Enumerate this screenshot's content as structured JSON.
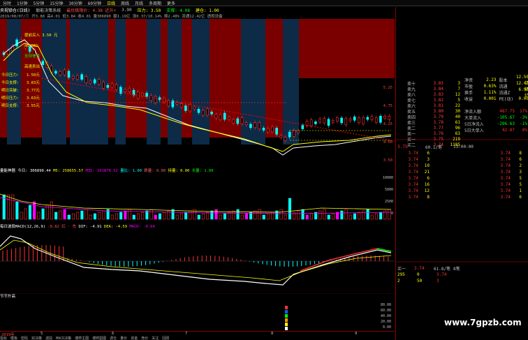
{
  "period_tabs": [
    "分时",
    "1分钟",
    "5分钟",
    "15分钟",
    "30分钟",
    "60分钟",
    "日线",
    "周线",
    "月线",
    "多周期",
    "更多"
  ],
  "active_period": "日线",
  "title": {
    "stock": "央视锁仓(日线)",
    "indicator": "聪能决策系统",
    "signal": "最优极限价: 4.38 近升+",
    "high": "3.90",
    "pressure": "压力: 3.50",
    "support": "支撑: 4.08",
    "position": "建仓: 1.00"
  },
  "info_line": "2019/08/07/三 开3.88 高4.01 低3.84 收4.01 量306890 额1.19亿 涨0.37/10.14% 换2.48% 流通12.42亿 透视设备",
  "main_annotations": {
    "buy_label": "提前买入 3.50 元",
    "a_label": "a0.86%",
    "support_label": "支持信号",
    "sell_label": "高速卖出",
    "today_pressure": "今日压力:",
    "today_support": "今日支撑:",
    "tomorrow_break": "明日突破:",
    "tomorrow_pressure": "明日压力:",
    "tomorrow_support": "明日支撑:",
    "tomorrow_low": "明日强势:"
  },
  "main_values": [
    "1.50元",
    "3.83元",
    "3.77元",
    "3.63元",
    "3.55元"
  ],
  "main_price_axis": [
    "5.25",
    "4.75",
    "4.25",
    "4.00",
    "3.50"
  ],
  "vol_header": {
    "name": "量能神器",
    "today": "今日: 306890.44",
    "m5": "M5: 258655.57",
    "m35": "M35: 101879.52",
    "vol_ratio": "量比: 1.00",
    "drop": "跌量: 0.00",
    "hold": "持量: 0.00",
    "long": "长量: 1.00"
  },
  "vol_axis": [
    "10000",
    "5000",
    "2500",
    "0"
  ],
  "macd_header": {
    "name": "每日波段MACD(12,26,9)",
    "dif_label": "DIF: -4.91",
    "dea_label": "DEA: -4.59",
    "macd_label": "MACD: -0.64",
    "extra": "-8.82 红 · 先"
  },
  "sig_header": {
    "name": "节节升高"
  },
  "sig_axis": [
    "80.00",
    "60.00",
    "40.00",
    "20.00",
    "0.00"
  ],
  "x_labels": [
    "2019年",
    "5",
    "6",
    "7",
    "8",
    "9"
  ],
  "bottom_tabs": [
    "指标",
    "模板",
    "密码",
    "双决策",
    "波段",
    "MACD决策",
    "博弈主图",
    "博弈副图",
    "调仓",
    "量价",
    "资金",
    "竞价",
    "关注",
    "回顾"
  ],
  "right_quotes": [
    {
      "label": "卖十",
      "price": "3.85",
      "vol": "3"
    },
    {
      "label": "卖九",
      "price": "3.84",
      "vol": "7"
    },
    {
      "label": "卖八",
      "price": "3.83",
      "vol": "12"
    },
    {
      "label": "卖七",
      "price": "3.82",
      "vol": "5"
    },
    {
      "label": "卖六",
      "price": "3.81",
      "vol": "22"
    },
    {
      "label": "卖五",
      "price": "3.80",
      "vol": "30"
    },
    {
      "label": "卖四",
      "price": "3.79",
      "vol": "40"
    },
    {
      "label": "卖三",
      "price": "3.78",
      "vol": "61"
    },
    {
      "label": "卖二",
      "price": "3.77",
      "vol": "96"
    },
    {
      "label": "卖一",
      "price": "3.76",
      "vol": "63"
    },
    {
      "label": "买一",
      "price": "3.75",
      "vol": "219"
    },
    {
      "label": "买二",
      "price": "3.74",
      "vol": "1185"
    }
  ],
  "fund_info": {
    "labels": [
      "净资",
      "市盈",
      "换手",
      "收益"
    ],
    "values": [
      "2.23",
      "0.63%",
      "1.11%",
      "0.001"
    ],
    "labels2": [
      "股本",
      "流通",
      "流通Z",
      "PE(动)"
    ],
    "values2": [
      "12.50亿",
      "12.42亿",
      "6.98亿",
      "0.00"
    ]
  },
  "flow_info": [
    {
      "label": "净流入额",
      "value": "487.75",
      "pct": "17%"
    },
    {
      "label": "大单流入",
      "value": "-105.67",
      "pct": "-3%"
    },
    {
      "label": "5日净流入",
      "value": "-296.63",
      "pct": "-1%"
    },
    {
      "label": "5日大单入",
      "value": "42.87",
      "pct": "0%"
    }
  ],
  "trade_summary": [
    "3.75",
    "60.1/笔",
    "13:00:00"
  ],
  "tick_rows": [
    [
      "3.74",
      "6",
      "3.74",
      "8"
    ],
    [
      "3.74",
      "3",
      "3.74",
      "6"
    ],
    [
      "3.74",
      "10",
      "3.74",
      "2"
    ],
    [
      "3.74",
      "21",
      "3.74",
      "3"
    ],
    [
      "3.74",
      "6",
      "3.74",
      "5"
    ],
    [
      "3.74",
      "16",
      "3.74",
      "5"
    ],
    [
      "3.74",
      "12",
      "3.74",
      "1"
    ],
    [
      "3.74",
      "8",
      "3.74",
      "6"
    ]
  ],
  "buysell_block": {
    "label": "买一",
    "values": [
      "3.74",
      "61.8/笔",
      "8笔"
    ],
    "rows": [
      [
        "295",
        "0",
        "3.74"
      ],
      [
        "2",
        "50",
        "3"
      ]
    ]
  },
  "watermark": "www.7gpzb.com",
  "colors": {
    "up": "#ff3030",
    "down": "#00ffff",
    "pressure_band": "#8b0000",
    "support_band": "#0d2a47"
  }
}
